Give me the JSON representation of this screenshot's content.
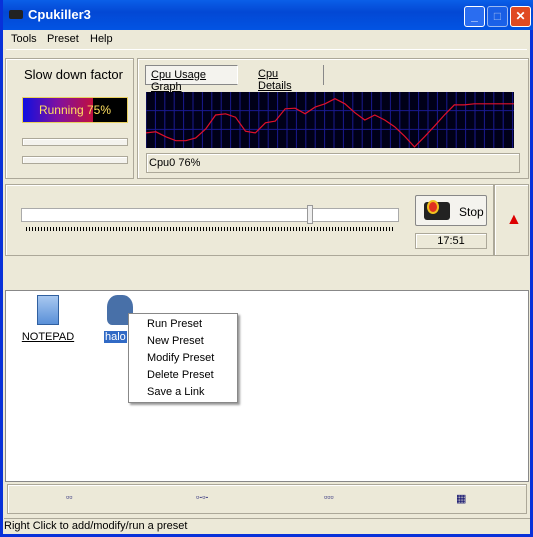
{
  "window": {
    "title": "Cpukiller3"
  },
  "menu": [
    "Tools",
    "Preset",
    "Help"
  ],
  "slow": {
    "label": "Slow down factor",
    "status": "Running 75%",
    "percent": 75
  },
  "tabs": [
    "Cpu Usage Graph",
    "Cpu Details"
  ],
  "graph": {
    "readout": "Cpu0 76%",
    "line_color": "#e0102a",
    "history": [
      27,
      29,
      20,
      13,
      13,
      18,
      34,
      59,
      61,
      55,
      30,
      27,
      45,
      48,
      70,
      71,
      61,
      73,
      79,
      88,
      79,
      63,
      50,
      59,
      50,
      38,
      21,
      2,
      20,
      39,
      59,
      77,
      77,
      79,
      79,
      79,
      79,
      79
    ]
  },
  "control": {
    "stop_label": "Stop",
    "timer": "17:51",
    "slider_percent": 75
  },
  "presets": [
    {
      "label": "NOTEPAD",
      "icon": "notepad-icon"
    },
    {
      "label": "halo",
      "icon": "halo-icon",
      "selected": true
    }
  ],
  "context_menu": [
    "Run Preset",
    "New Preset",
    "Modify Preset",
    "Delete Preset",
    "Save a Link"
  ],
  "status": "Right Click to add/modify/run a preset"
}
